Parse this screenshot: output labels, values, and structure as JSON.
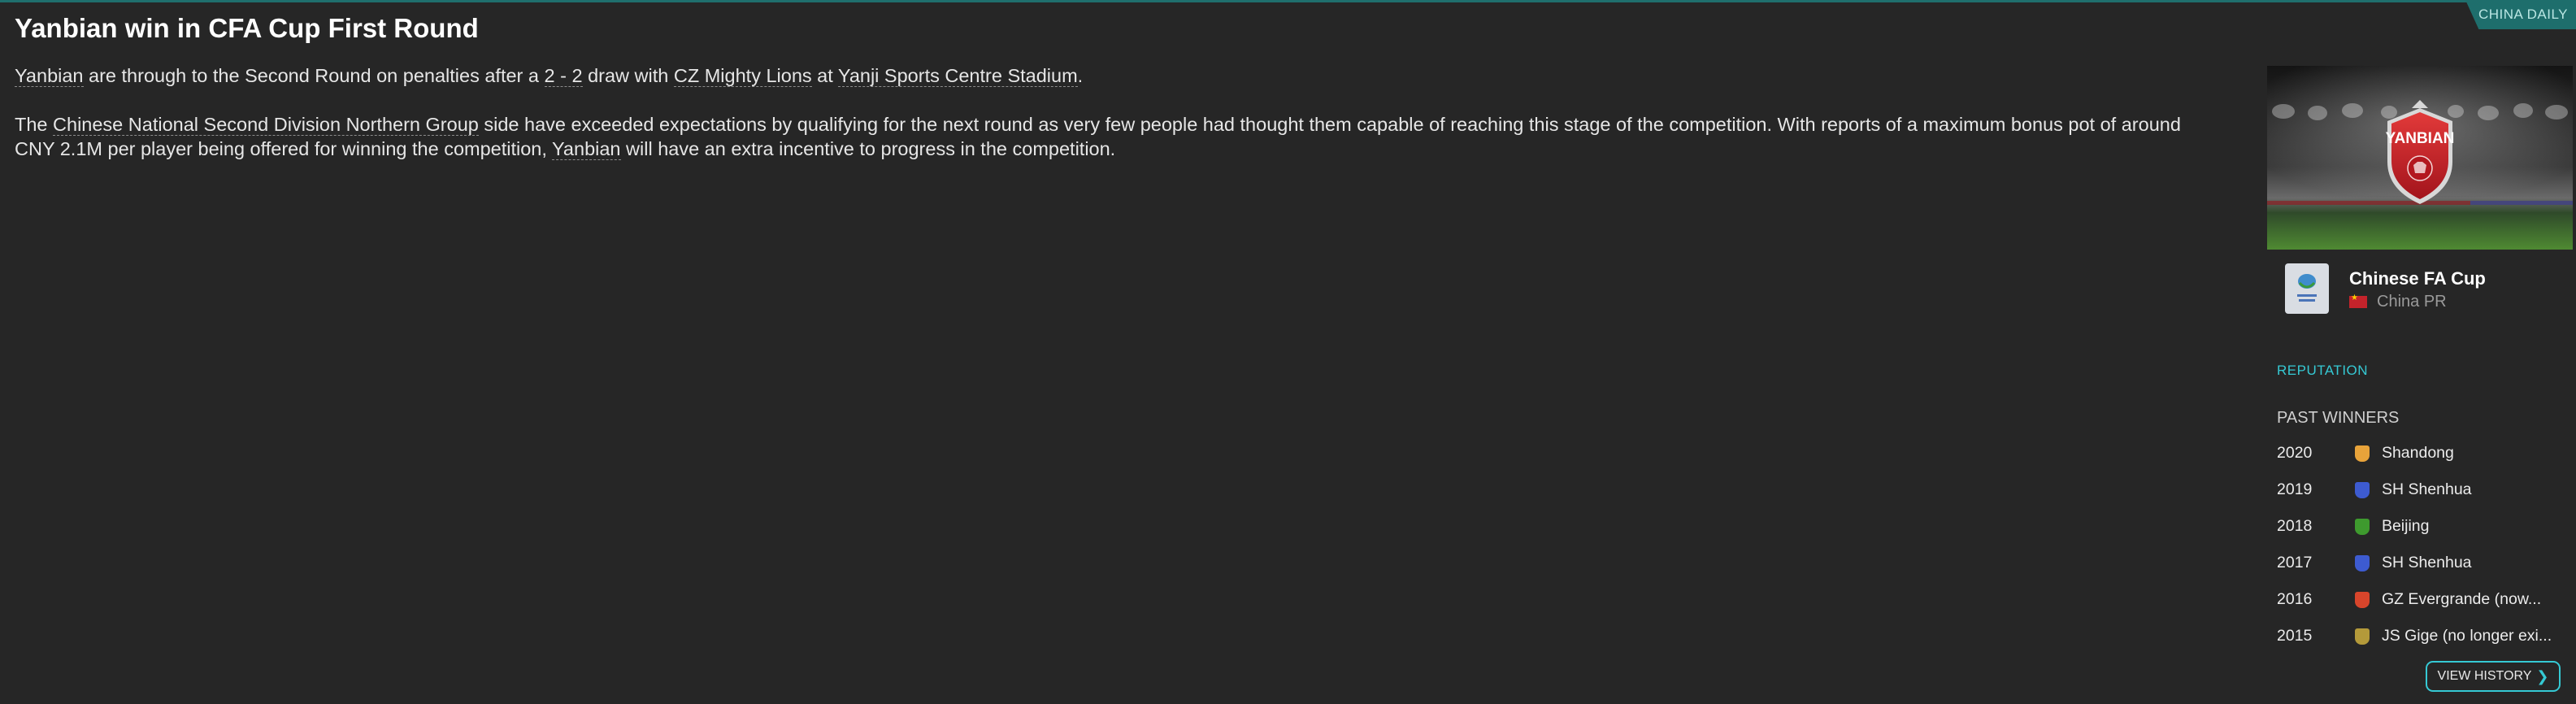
{
  "header": {
    "source_tag": "CHINA DAILY",
    "headline": "Yanbian win in CFA Cup First Round"
  },
  "article": {
    "p1": {
      "team": "Yanbian",
      "t1": " are through to the Second Round on penalties after a ",
      "score": "2 - 2",
      "t2": " draw with ",
      "opponent": "CZ Mighty Lions",
      "t3": " at ",
      "stadium": "Yanji Sports Centre Stadium",
      "t4": "."
    },
    "p2": {
      "t1": "The ",
      "division": "Chinese National Second Division Northern Group",
      "t2": " side have exceeded expectations by qualifying for the next round as very few people had thought them capable of reaching this stage of the competition. With reports of a maximum bonus pot of around CNY 2.1M per player being offered for winning the competition, ",
      "team": "Yanbian",
      "t3": " will have an extra incentive to progress in the competition."
    }
  },
  "sidebar": {
    "hero_crest_text": "YANBIAN",
    "competition": {
      "name": "Chinese FA Cup",
      "country": "China PR",
      "logo_icon": "fa-cup-logo-icon"
    },
    "reputation_label": "REPUTATION",
    "past_winners_label": "PAST WINNERS",
    "past_winners": [
      {
        "year": "2020",
        "club": "Shandong",
        "badge_color": "#e8a33a"
      },
      {
        "year": "2019",
        "club": "SH Shenhua",
        "badge_color": "#3d5bd0"
      },
      {
        "year": "2018",
        "club": "Beijing",
        "badge_color": "#3e9a2e"
      },
      {
        "year": "2017",
        "club": "SH Shenhua",
        "badge_color": "#3d5bd0"
      },
      {
        "year": "2016",
        "club": "GZ Evergrande (now...",
        "badge_color": "#d8452b"
      },
      {
        "year": "2015",
        "club": "JS Gige (no longer exi...",
        "badge_color": "#b49a3a"
      }
    ],
    "view_history_label": "VIEW HISTORY"
  },
  "colors": {
    "background": "#262626",
    "accent": "#35c9d4",
    "source_tag_bg": "#1e6e6c",
    "crest_red": "#c8202a"
  }
}
